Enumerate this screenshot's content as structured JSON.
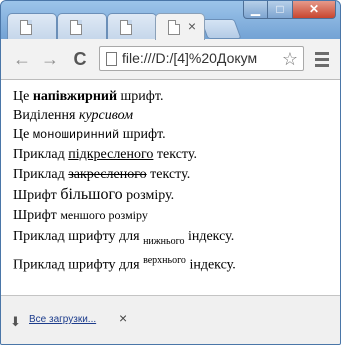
{
  "tabs": [
    {
      "label": "",
      "active": false
    },
    {
      "label": "",
      "active": false
    },
    {
      "label": "",
      "active": false
    },
    {
      "label": "",
      "active": true,
      "close": "×"
    }
  ],
  "window_controls": {
    "minimize": "▁",
    "maximize": "□",
    "close": "✕"
  },
  "toolbar": {
    "back": "←",
    "forward": "→",
    "reload": "C",
    "url": "file:///D:/[4]%20Докум",
    "star": "☆"
  },
  "content": {
    "line1": {
      "pre": "Це ",
      "bold": "напівжирний",
      "post": " шрифт."
    },
    "line2": {
      "pre": "Виділення ",
      "italic": "курсивом"
    },
    "line3": {
      "pre": "Це ",
      "mono": "моноширинний",
      "post": " шрифт."
    },
    "line4": {
      "pre": "Приклад ",
      "underline": "підкресленого",
      "post": " тексту."
    },
    "line5": {
      "pre": "Приклад ",
      "strike": "закресленого",
      "post": " тексту."
    },
    "line6": {
      "pre": "Шрифт ",
      "big": "більшого",
      "post": " розміру."
    },
    "line7": {
      "pre": "Шрифт ",
      "small": "меншого розміру"
    },
    "line8": {
      "pre": "Приклад шрифту для ",
      "sub": "нижнього",
      "post": " індексу."
    },
    "line9": {
      "pre": "Приклад шрифту для ",
      "sup": "верхнього",
      "post": " індексу."
    }
  },
  "downloads": {
    "link": "Все загрузки...",
    "close": "×",
    "icon": "download-arrow-icon"
  }
}
